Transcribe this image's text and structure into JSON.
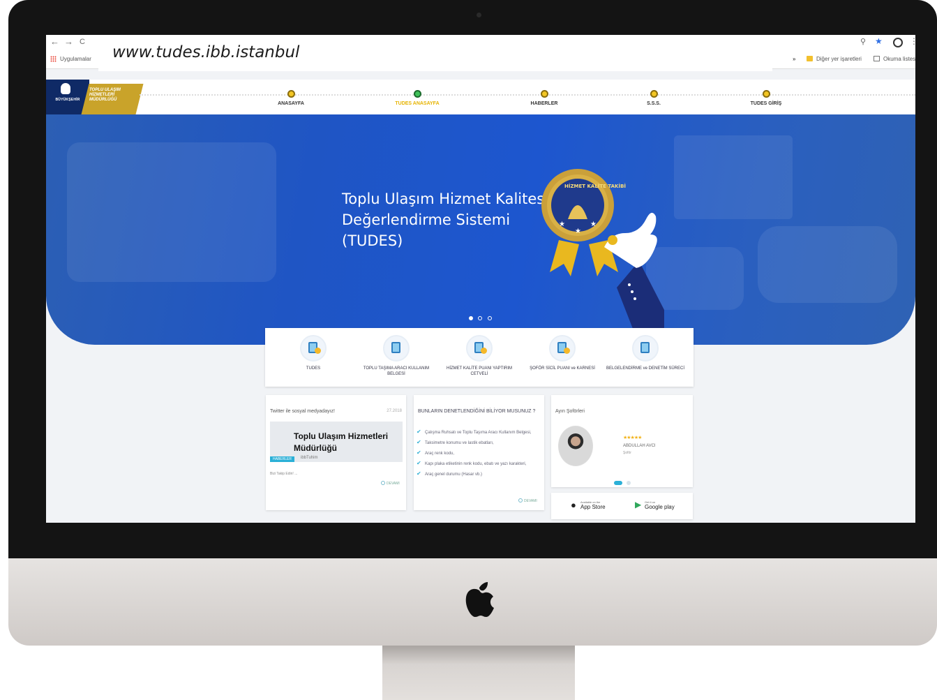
{
  "browser": {
    "nav_back": "←",
    "nav_forward": "→",
    "nav_reload": "C",
    "url": "www.tudes.ibb.istanbul",
    "bookmarks": {
      "apps_label": "Uygulamalar",
      "more": "»",
      "other_bookmarks": "Diğer yer işaretleri",
      "reading_list": "Okuma listesi"
    },
    "icons": {
      "search": "search-icon",
      "star": "star-icon",
      "profile": "profile-icon",
      "menu": "menu-icon"
    }
  },
  "logo": {
    "institution": "BÜYÜKŞEHİR",
    "department": "TOPLU ULAŞIM HİZMETLERİ MÜDÜRLÜĞÜ"
  },
  "nav": {
    "items": [
      {
        "label": "ANASAYFA",
        "active": false
      },
      {
        "label": "TUDES ANASAYFA",
        "active": true
      },
      {
        "label": "HABERLER",
        "active": false
      },
      {
        "label": "S.S.S.",
        "active": false
      },
      {
        "label": "TUDES GİRİŞ",
        "active": false
      }
    ]
  },
  "hero": {
    "title": "Toplu Ulaşım Hizmet Kalitesi Değerlendirme Sistemi (TUDES)",
    "seal_text": "HİZMET KALİTE TAKİBİ",
    "slide_count": 3,
    "active_slide": 1
  },
  "quick_links": [
    {
      "label": "TUDES",
      "icon": "tudes-icon"
    },
    {
      "label": "TOPLU TAŞIMA ARACI KULLANIM BELGESİ",
      "icon": "document-icon"
    },
    {
      "label": "HİZMET KALİTE PUANI YAPTIRIM CETVELİ",
      "icon": "ticket-icon"
    },
    {
      "label": "ŞOFÖR SİCİL PUANI ve KARNESİ",
      "icon": "report-icon"
    },
    {
      "label": "BELGELENDİRME ve DENETİM SÜRECİ",
      "icon": "certificate-icon"
    }
  ],
  "social_card": {
    "header": "Twitter ile sosyal medyadayız!",
    "date": "27.2018",
    "news_title": "Toplu Ulaşım Hizmetleri Müdürlüğü",
    "badge": "HABERLER",
    "sub": "ibbTuhim",
    "follow": "Bizi Takip Edin! ...",
    "more": "DEVAMI"
  },
  "check_card": {
    "title": "BUNLARIN DENETLENDİĞİNİ BİLİYOR MUSUNUZ ?",
    "items": [
      "Çalışma Ruhsatı ve Toplu Taşıma Aracı Kullanım Belgesi,",
      "Taksimetre konumu ve lastik ebatları,",
      "Araç renk kodu,",
      "Kapı plaka etiketinin renk kodu, ebatı ve yazı karakteri,",
      "Araç genel durumu (Hasar vb.)"
    ],
    "more": "DEVAMI"
  },
  "drivers_card": {
    "header": "Ayın Şoförleri",
    "stars": "★★★★★",
    "name": "ABDULLAH AVCI",
    "role": "Şoför",
    "slide_count": 2,
    "active_slide": 1
  },
  "app_store": {
    "apple_small": "Available on the",
    "apple_big": "App Store",
    "google_small": "Get it on",
    "google_big": "Google play"
  },
  "colors": {
    "hero_blue": "#1d56cf",
    "nav_gold": "#f3c623",
    "nav_active": "#3fc159",
    "accent_cyan": "#2bb0d7"
  }
}
